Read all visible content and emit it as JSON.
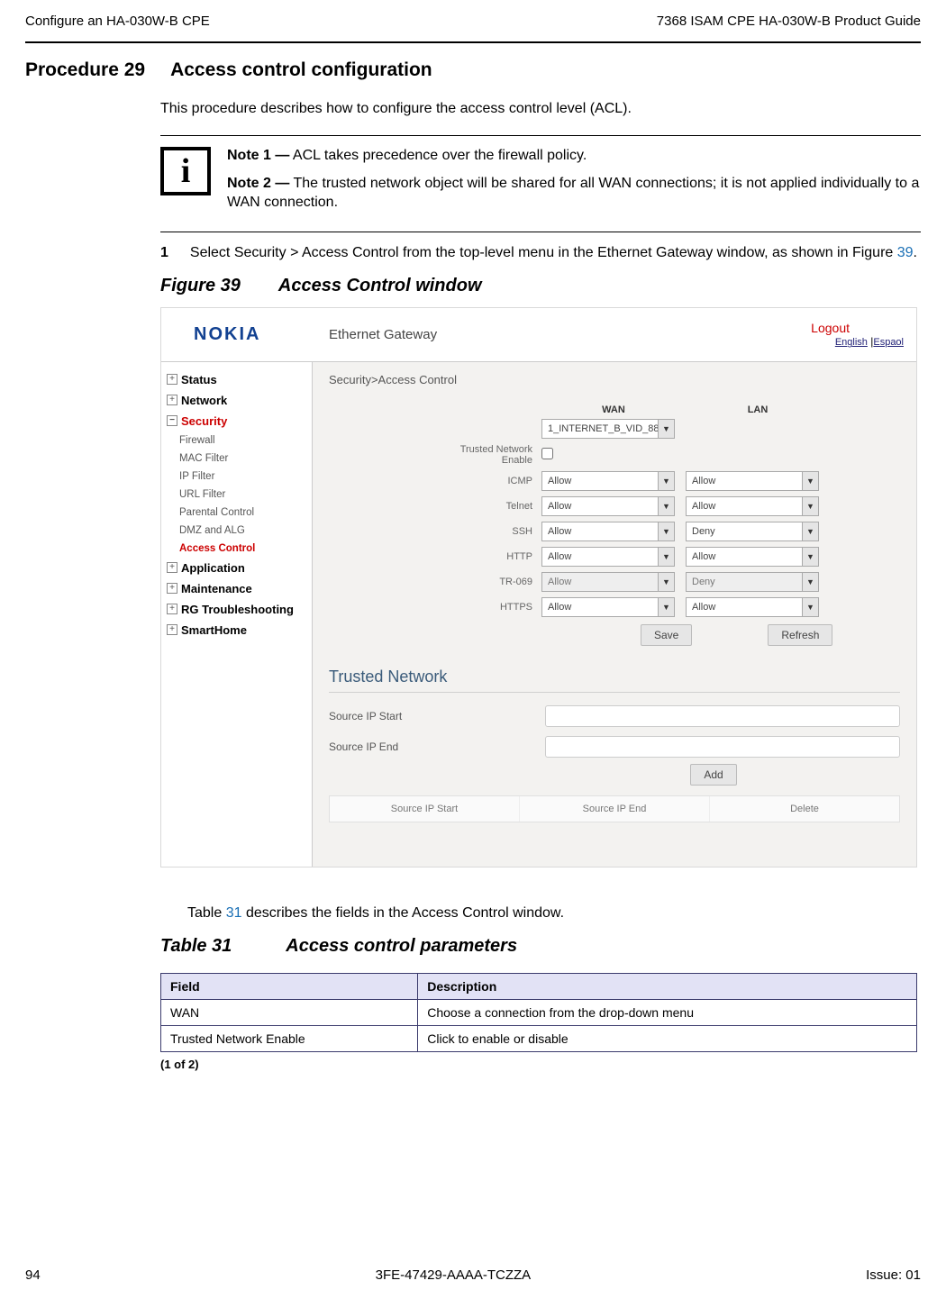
{
  "header": {
    "left": "Configure an HA-030W-B CPE",
    "right": "7368 ISAM CPE HA-030W-B Product Guide"
  },
  "procedure": {
    "label": "Procedure 29",
    "title": "Access control configuration"
  },
  "intro": "This procedure describes how to configure the access control level (ACL).",
  "notes": {
    "n1_label": "Note 1 —",
    "n1_text": " ACL takes precedence over the firewall policy.",
    "n2_label": "Note 2 —",
    "n2_text": " The trusted network object will be shared for all WAN connections; it is not applied individually to a WAN connection."
  },
  "step": {
    "num": "1",
    "text_pre": "Select Security > Access Control from the top-level menu in the Ethernet Gateway window, as shown in Figure ",
    "link": "39",
    "text_post": "."
  },
  "figure": {
    "label": "Figure 39",
    "title": "Access Control window"
  },
  "shot": {
    "logo": "NOKIA",
    "gateway_label": "Ethernet Gateway",
    "logout": "Logout",
    "lang_en": "English",
    "lang_sep": " |",
    "lang_es": "Espaol",
    "sidebar": {
      "status": "Status",
      "network": "Network",
      "security": "Security",
      "subs": {
        "firewall": "Firewall",
        "mac": "MAC Filter",
        "ip": "IP Filter",
        "url": "URL Filter",
        "parental": "Parental Control",
        "dmz": "DMZ and ALG",
        "acl": "Access Control"
      },
      "application": "Application",
      "maintenance": "Maintenance",
      "rg": "RG Troubleshooting",
      "smart": "SmartHome"
    },
    "crumb": "Security>Access Control",
    "cols": {
      "wan": "WAN",
      "lan": "LAN"
    },
    "wan_sel": "1_INTERNET_B_VID_88",
    "tne_label": "Trusted Network Enable",
    "rows": {
      "icmp": "ICMP",
      "telnet": "Telnet",
      "ssh": "SSH",
      "http": "HTTP",
      "tr069": "TR-069",
      "https": "HTTPS"
    },
    "allow": "Allow",
    "deny": "Deny",
    "save": "Save",
    "refresh": "Refresh",
    "tn_title": "Trusted Network",
    "src_start": "Source IP Start",
    "src_end": "Source IP End",
    "add": "Add",
    "tbl_cols": {
      "c1": "Source IP Start",
      "c2": "Source IP End",
      "c3": "Delete"
    }
  },
  "table_intro_pre": "Table ",
  "table_intro_link": "31",
  "table_intro_post": " describes the fields in the Access Control window.",
  "table_title": {
    "label": "Table 31",
    "title": "Access control parameters"
  },
  "param_table": {
    "head_field": "Field",
    "head_desc": "Description",
    "r1f": "WAN",
    "r1d": "Choose a connection from the drop-down menu",
    "r2f": "Trusted Network Enable",
    "r2d": "Click to enable or disable"
  },
  "pagenote": "(1 of 2)",
  "footer": {
    "page": "94",
    "doc": "3FE-47429-AAAA-TCZZA",
    "issue": "Issue: 01"
  }
}
